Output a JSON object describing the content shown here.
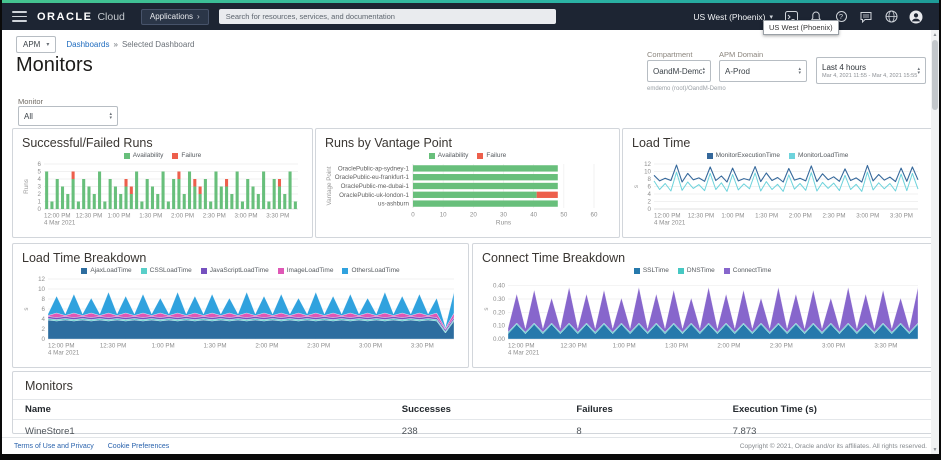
{
  "topbar": {
    "logo_oracle": "ORACLE",
    "logo_cloud": "Cloud",
    "applications_label": "Applications",
    "search_placeholder": "Search for resources, services, and documentation",
    "region": "US West (Phoenix)",
    "region_tooltip": "US West (Phoenix)"
  },
  "breadcrumb": {
    "app_selector": "APM",
    "link": "Dashboards",
    "separator": "»",
    "current": "Selected Dashboard"
  },
  "page": {
    "title": "Monitors"
  },
  "filters": {
    "compartment_label": "Compartment",
    "compartment_value": "OandM-Demo",
    "compartment_path": "emdemo (root)/OandM-Demo",
    "apm_domain_label": "APM Domain",
    "apm_domain_value": "A-Prod",
    "time_range_label": "Last 4 hours",
    "time_range_detail": "Mar 4, 2021 11:55 - Mar 4, 2021 15:55",
    "monitor_label": "Monitor",
    "monitor_value": "All"
  },
  "table": {
    "title": "Monitors",
    "columns": [
      "Name",
      "Successes",
      "Failures",
      "Execution Time (s)"
    ],
    "rows": [
      [
        "WineStore1",
        "238",
        "8",
        "7.873"
      ]
    ]
  },
  "footer": {
    "link1": "Terms of Use and Privacy",
    "link2": "Cookie Preferences",
    "copyright": "Copyright © 2021, Oracle and/or its affiliates. All rights reserved."
  },
  "chart_data": [
    {
      "type": "bar",
      "title": "Successful/Failed Runs",
      "ylabel": "Runs",
      "ylim": [
        0,
        6
      ],
      "yticks": [
        "0",
        "1",
        "2",
        "3",
        "4",
        "5",
        "6"
      ],
      "x_tick_labels": [
        "12:00 PM",
        "12:30 PM",
        "1:00 PM",
        "1:30 PM",
        "2:00 PM",
        "2:30 PM",
        "3:00 PM",
        "3:30 PM"
      ],
      "x_sub_label": "4 Mar 2021",
      "series": [
        {
          "name": "Availability",
          "color": "#68bf7b",
          "values": [
            5,
            1,
            4,
            3,
            2,
            4,
            1,
            4,
            3,
            2,
            5,
            1,
            4,
            3,
            2,
            3,
            2,
            5,
            1,
            4,
            3,
            2,
            5,
            1,
            4,
            4,
            2,
            5,
            3,
            2,
            4,
            1,
            5,
            3,
            3,
            2,
            5,
            1,
            4,
            3,
            2,
            5,
            1,
            4,
            3,
            2,
            5,
            1
          ]
        },
        {
          "name": "Failure",
          "color": "#ed5f4c",
          "values": [
            0,
            0,
            0,
            0,
            0,
            1,
            0,
            0,
            0,
            0,
            0,
            0,
            0,
            0,
            0,
            1,
            1,
            0,
            0,
            0,
            0,
            0,
            0,
            0,
            0,
            1,
            0,
            0,
            1,
            1,
            0,
            0,
            0,
            0,
            1,
            0,
            0,
            0,
            0,
            0,
            0,
            0,
            0,
            0,
            1,
            0,
            0,
            0
          ]
        }
      ]
    },
    {
      "type": "hbar",
      "title": "Runs by Vantage Point",
      "xlabel": "Runs",
      "ylabel": "Vantage Point",
      "xlim": [
        0,
        60
      ],
      "xticks": [
        "0",
        "10",
        "20",
        "30",
        "40",
        "50",
        "60"
      ],
      "categories": [
        "OraclePublic-ap-sydney-1",
        "OraclePublic-eu-frankfurt-1",
        "OraclePublic-me-dubai-1",
        "OraclePublic-uk-london-1",
        "us-ashburn"
      ],
      "series": [
        {
          "name": "Availability",
          "color": "#68bf7b",
          "values": [
            48,
            48,
            48,
            41,
            48
          ]
        },
        {
          "name": "Failure",
          "color": "#ed5f4c",
          "values": [
            0,
            0,
            0,
            7,
            0
          ]
        }
      ]
    },
    {
      "type": "line",
      "title": "Load Time",
      "ylabel": "s",
      "ylim": [
        0,
        12
      ],
      "yticks": [
        "0",
        "2",
        "4",
        "6",
        "8",
        "10",
        "12"
      ],
      "x_tick_labels": [
        "12:00 PM",
        "12:30 PM",
        "1:00 PM",
        "1:30 PM",
        "2:00 PM",
        "2:30 PM",
        "3:00 PM",
        "3:30 PM"
      ],
      "x_sub_label": "4 Mar 2021",
      "series": [
        {
          "name": "MonitorExecutionTime",
          "color": "#35689b",
          "values": [
            9.0,
            7.5,
            8.2,
            7.6,
            11.7,
            7.2,
            9.5,
            7.8,
            8.3,
            7.4,
            11.2,
            7.6,
            8.8,
            7.2,
            10.9,
            7.5,
            8.1,
            7.7,
            11.3,
            7.3,
            9.6,
            7.6,
            8.4,
            7.2,
            10.8,
            7.7,
            8.2,
            7.5,
            11.5,
            7.3,
            9.4,
            7.8,
            8.6,
            7.4,
            10.7,
            7.6,
            8.3,
            7.2,
            11.6,
            7.5,
            9.2,
            7.7,
            8.5,
            7.3,
            10.9,
            7.4,
            11.2,
            7.8
          ]
        },
        {
          "name": "MonitorLoadTime",
          "color": "#6ed3dc",
          "values": [
            7.5,
            5.2,
            6.8,
            4.8,
            9.8,
            5.0,
            7.2,
            5.5,
            6.5,
            4.9,
            9.5,
            5.2,
            7.0,
            4.7,
            9.2,
            5.1,
            6.7,
            5.4,
            9.6,
            4.8,
            7.3,
            5.2,
            6.6,
            4.7,
            9.1,
            5.3,
            6.8,
            5.0,
            9.7,
            4.8,
            7.1,
            5.5,
            6.9,
            4.9,
            9.0,
            5.2,
            6.6,
            4.7,
            9.8,
            5.1,
            7.0,
            5.4,
            6.8,
            4.8,
            9.3,
            4.9,
            9.5,
            5.3
          ]
        }
      ]
    },
    {
      "type": "area",
      "title": "Load Time Breakdown",
      "ylabel": "s",
      "ylim": [
        0,
        12
      ],
      "yticks": [
        "0",
        "2",
        "4",
        "6",
        "8",
        "10",
        "12"
      ],
      "x_tick_labels": [
        "12:00 PM",
        "12:30 PM",
        "1:00 PM",
        "1:30 PM",
        "2:00 PM",
        "2:30 PM",
        "3:00 PM",
        "3:30 PM"
      ],
      "x_sub_label": "4 Mar 2021",
      "series": [
        {
          "name": "AjaxLoadTime",
          "color": "#2d6d9f",
          "values": [
            3.8,
            3.6,
            3.8,
            3.6,
            3.8,
            3.6,
            3.8,
            3.6,
            3.8,
            3.6,
            3.8,
            3.6,
            3.8,
            3.6,
            3.8,
            3.6,
            3.8,
            3.6,
            3.8,
            3.6,
            3.8,
            3.6,
            3.8,
            3.6,
            3.8,
            3.6,
            3.8,
            3.6,
            3.8,
            3.6,
            3.8,
            3.6,
            3.8,
            3.6,
            3.8,
            3.6,
            3.8,
            3.6,
            3.8,
            3.6,
            3.8,
            3.6,
            3.8,
            3.6,
            3.8,
            3.6,
            1.2,
            3.6
          ]
        },
        {
          "name": "CSSLoadTime",
          "color": "#59cfc9",
          "values": [
            0.3,
            0.3,
            0.3,
            0.3,
            0.3,
            0.3,
            0.3,
            0.3,
            0.3,
            0.3,
            0.3,
            0.3,
            0.3,
            0.3,
            0.3,
            0.3,
            0.3,
            0.3,
            0.3,
            0.3,
            0.3,
            0.3,
            0.3,
            0.3,
            0.3,
            0.3,
            0.3,
            0.3,
            0.3,
            0.3,
            0.3,
            0.3,
            0.3,
            0.3,
            0.3,
            0.3,
            0.3,
            0.3,
            0.3,
            0.3,
            0.3,
            0.3,
            0.3,
            0.3,
            0.3,
            0.3,
            0.3,
            0.3
          ]
        },
        {
          "name": "JavaScriptLoadTime",
          "color": "#7551bf",
          "values": [
            0.4,
            0.4,
            0.4,
            0.4,
            0.4,
            0.4,
            0.4,
            0.4,
            0.4,
            0.4,
            0.4,
            0.4,
            0.4,
            0.4,
            0.4,
            0.4,
            0.4,
            0.4,
            0.4,
            0.4,
            0.4,
            0.4,
            0.4,
            0.4,
            0.4,
            0.4,
            0.4,
            0.4,
            0.4,
            0.4,
            0.4,
            0.4,
            0.4,
            0.4,
            0.4,
            0.4,
            0.4,
            0.4,
            0.4,
            0.4,
            0.4,
            0.4,
            0.4,
            0.4,
            0.4,
            0.4,
            0.4,
            0.4
          ]
        },
        {
          "name": "ImageLoadTime",
          "color": "#df58b6",
          "values": [
            0.2,
            0.9,
            0.2,
            0.9,
            0.2,
            0.9,
            0.2,
            0.9,
            0.2,
            0.9,
            0.2,
            0.9,
            0.2,
            0.9,
            0.2,
            0.9,
            0.2,
            0.9,
            0.2,
            0.9,
            0.2,
            0.9,
            0.2,
            0.9,
            0.2,
            0.9,
            0.2,
            0.9,
            0.2,
            0.9,
            0.2,
            0.9,
            0.2,
            0.9,
            0.2,
            0.9,
            0.2,
            0.9,
            0.2,
            0.9,
            0.2,
            0.9,
            0.2,
            0.9,
            0.2,
            0.9,
            0.2,
            0.9
          ]
        },
        {
          "name": "OthersLoadTime",
          "color": "#30a2de",
          "values": [
            0.3,
            3.4,
            0.3,
            3.8,
            0.3,
            3.0,
            0.3,
            4.2,
            0.3,
            3.4,
            0.3,
            3.8,
            0.3,
            3.0,
            0.3,
            4.2,
            0.3,
            3.4,
            0.3,
            3.8,
            0.3,
            3.0,
            0.3,
            4.2,
            0.3,
            3.4,
            0.3,
            3.8,
            0.3,
            3.0,
            0.3,
            4.2,
            0.3,
            3.4,
            0.3,
            3.8,
            0.3,
            3.0,
            0.3,
            4.2,
            0.3,
            3.4,
            0.3,
            3.8,
            0.3,
            3.0,
            0.3,
            4.2
          ]
        }
      ]
    },
    {
      "type": "area",
      "title": "Connect Time Breakdown",
      "ylabel": "s",
      "ylim": [
        0,
        0.45
      ],
      "yticks": [
        "0.00",
        "0.10",
        "0.20",
        "0.30",
        "0.40"
      ],
      "x_tick_labels": [
        "12:00 PM",
        "12:30 PM",
        "1:00 PM",
        "1:30 PM",
        "2:00 PM",
        "2:30 PM",
        "3:00 PM",
        "3:30 PM"
      ],
      "x_sub_label": "4 Mar 2021",
      "series": [
        {
          "name": "SSLTime",
          "color": "#2679ac",
          "values": [
            0.04,
            0.11,
            0.04,
            0.11,
            0.04,
            0.11,
            0.04,
            0.11,
            0.04,
            0.11,
            0.04,
            0.11,
            0.04,
            0.11,
            0.04,
            0.11,
            0.04,
            0.11,
            0.04,
            0.11,
            0.04,
            0.11,
            0.04,
            0.11,
            0.04,
            0.11,
            0.04,
            0.11,
            0.04,
            0.11,
            0.04,
            0.11,
            0.04,
            0.11,
            0.04,
            0.11,
            0.04,
            0.11,
            0.04,
            0.11,
            0.04,
            0.11,
            0.04,
            0.11,
            0.04,
            0.11,
            0.04,
            0.11
          ]
        },
        {
          "name": "DNSTime",
          "color": "#46c8c3",
          "values": [
            0.01,
            0.01,
            0.01,
            0.01,
            0.01,
            0.01,
            0.01,
            0.01,
            0.01,
            0.01,
            0.01,
            0.01,
            0.01,
            0.01,
            0.01,
            0.01,
            0.01,
            0.01,
            0.01,
            0.01,
            0.01,
            0.01,
            0.01,
            0.01,
            0.01,
            0.01,
            0.01,
            0.01,
            0.01,
            0.01,
            0.01,
            0.01,
            0.01,
            0.01,
            0.01,
            0.01,
            0.01,
            0.01,
            0.01,
            0.01,
            0.01,
            0.01,
            0.01,
            0.01,
            0.01,
            0.01,
            0.01,
            0.01
          ]
        },
        {
          "name": "ConnectTime",
          "color": "#8766cc",
          "values": [
            0.03,
            0.22,
            0.03,
            0.25,
            0.03,
            0.19,
            0.03,
            0.27,
            0.03,
            0.22,
            0.03,
            0.25,
            0.03,
            0.19,
            0.03,
            0.27,
            0.03,
            0.22,
            0.03,
            0.25,
            0.03,
            0.19,
            0.03,
            0.27,
            0.03,
            0.22,
            0.03,
            0.25,
            0.03,
            0.19,
            0.03,
            0.27,
            0.03,
            0.22,
            0.03,
            0.25,
            0.03,
            0.19,
            0.03,
            0.27,
            0.03,
            0.22,
            0.03,
            0.25,
            0.03,
            0.19,
            0.03,
            0.27
          ]
        }
      ]
    }
  ]
}
